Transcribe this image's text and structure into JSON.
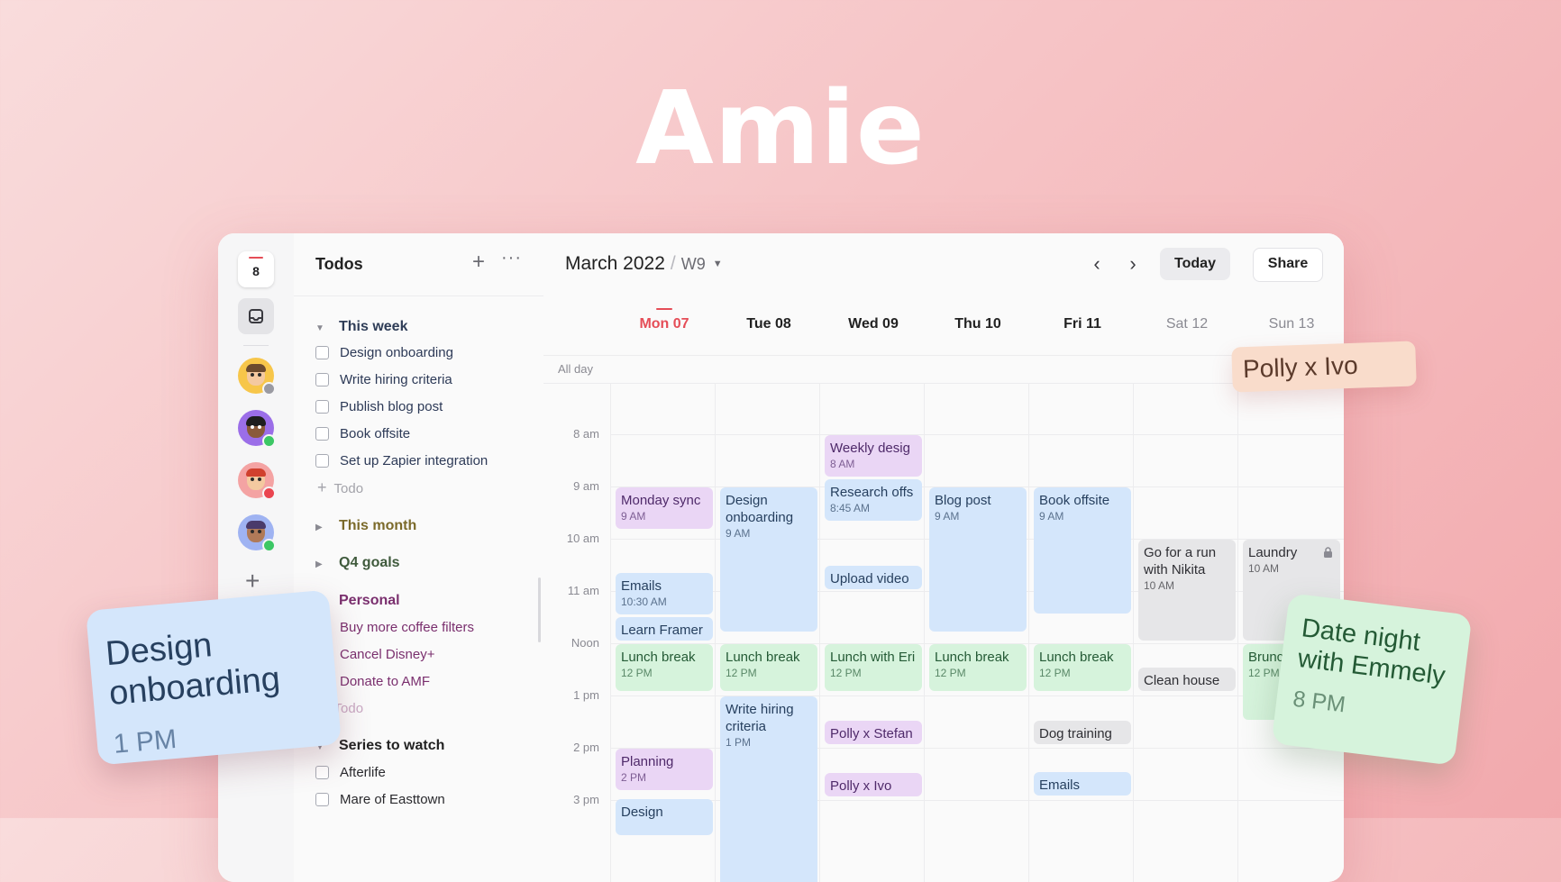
{
  "brand": {
    "title": "Amie"
  },
  "rail": {
    "calendar_day": "8",
    "avatars": [
      {
        "status": "away"
      },
      {
        "status": "online"
      },
      {
        "status": "busy"
      },
      {
        "status": "online"
      }
    ],
    "colors": {
      "online": "#3cc765",
      "busy": "#ea4550",
      "away": "#9a9aa2"
    }
  },
  "todos": {
    "title": "Todos",
    "add_label": "Todo",
    "sections": [
      {
        "name": "This week",
        "color": "#2f3d57",
        "expanded": true,
        "items": [
          "Design onboarding",
          "Write hiring criteria",
          "Publish blog post",
          "Book offsite",
          "Set up Zapier integration"
        ]
      },
      {
        "name": "This month",
        "color": "#7b6a2a",
        "expanded": false,
        "items": []
      },
      {
        "name": "Q4 goals",
        "color": "#3f5a3c",
        "expanded": false,
        "items": []
      },
      {
        "name": "Personal",
        "color": "#7a2f6e",
        "expanded": true,
        "items": [
          "Buy more coffee filters",
          "Cancel Disney+",
          "Donate to AMF"
        ]
      },
      {
        "name": "Series to watch",
        "color": "#222222",
        "expanded": true,
        "items": [
          "Afterlife",
          "Mare of Easttown"
        ]
      }
    ]
  },
  "calendar": {
    "month": "March 2022",
    "week": "W9",
    "today_label": "Today",
    "share_label": "Share",
    "allday_label": "All day",
    "days": [
      "Mon 07",
      "Tue 08",
      "Wed 09",
      "Thu 10",
      "Fri 11",
      "Sat 12",
      "Sun 13"
    ],
    "today_index": 0,
    "times": [
      "8 am",
      "9 am",
      "10 am",
      "11 am",
      "Noon",
      "1 pm",
      "2 pm",
      "3 pm"
    ],
    "events": {
      "weekly_design": {
        "title": "Weekly desig",
        "time": "8 AM"
      },
      "monday_sync": {
        "title": "Monday sync",
        "time": "9 AM"
      },
      "design_onboarding": {
        "title": "Design onboarding",
        "time": "9 AM"
      },
      "research": {
        "title": "Research offs",
        "time": "8:45 AM"
      },
      "blog_post": {
        "title": "Blog post",
        "time": "9 AM"
      },
      "book_offsite": {
        "title": "Book offsite",
        "time": "9 AM"
      },
      "run": {
        "title": "Go for a run with Nikita",
        "time": "10 AM"
      },
      "laundry": {
        "title": "Laundry",
        "time": "10 AM"
      },
      "upload_video": {
        "title": "Upload video"
      },
      "emails_mon": {
        "title": "Emails",
        "time": "10:30 AM"
      },
      "learn_framer": {
        "title": "Learn Framer"
      },
      "lunch_mon": {
        "title": "Lunch break",
        "time": "12 PM"
      },
      "lunch_tue": {
        "title": "Lunch break",
        "time": "12 PM"
      },
      "lunch_wed": {
        "title": "Lunch with Eri",
        "time": "12 PM"
      },
      "lunch_thu": {
        "title": "Lunch break",
        "time": "12 PM"
      },
      "lunch_fri": {
        "title": "Lunch break",
        "time": "12 PM"
      },
      "brunch": {
        "title": "Brunc",
        "time": "12 PM"
      },
      "clean_house": {
        "title": "Clean house"
      },
      "write_hiring": {
        "title": "Write hiring criteria",
        "time": "1 PM"
      },
      "polly_stefan": {
        "title": "Polly x Stefan"
      },
      "dog_training": {
        "title": "Dog training"
      },
      "planning": {
        "title": "Planning",
        "time": "2 PM"
      },
      "polly_ivo": {
        "title": "Polly x Ivo"
      },
      "emails_fri": {
        "title": "Emails"
      },
      "design_mon": {
        "title": "Design"
      }
    }
  },
  "floating": {
    "polly": {
      "title": "Polly x Ivo"
    },
    "design": {
      "title": "Design onboarding",
      "time": "1 PM"
    },
    "date": {
      "title": "Date night with Emmely",
      "time": "8 PM"
    }
  }
}
